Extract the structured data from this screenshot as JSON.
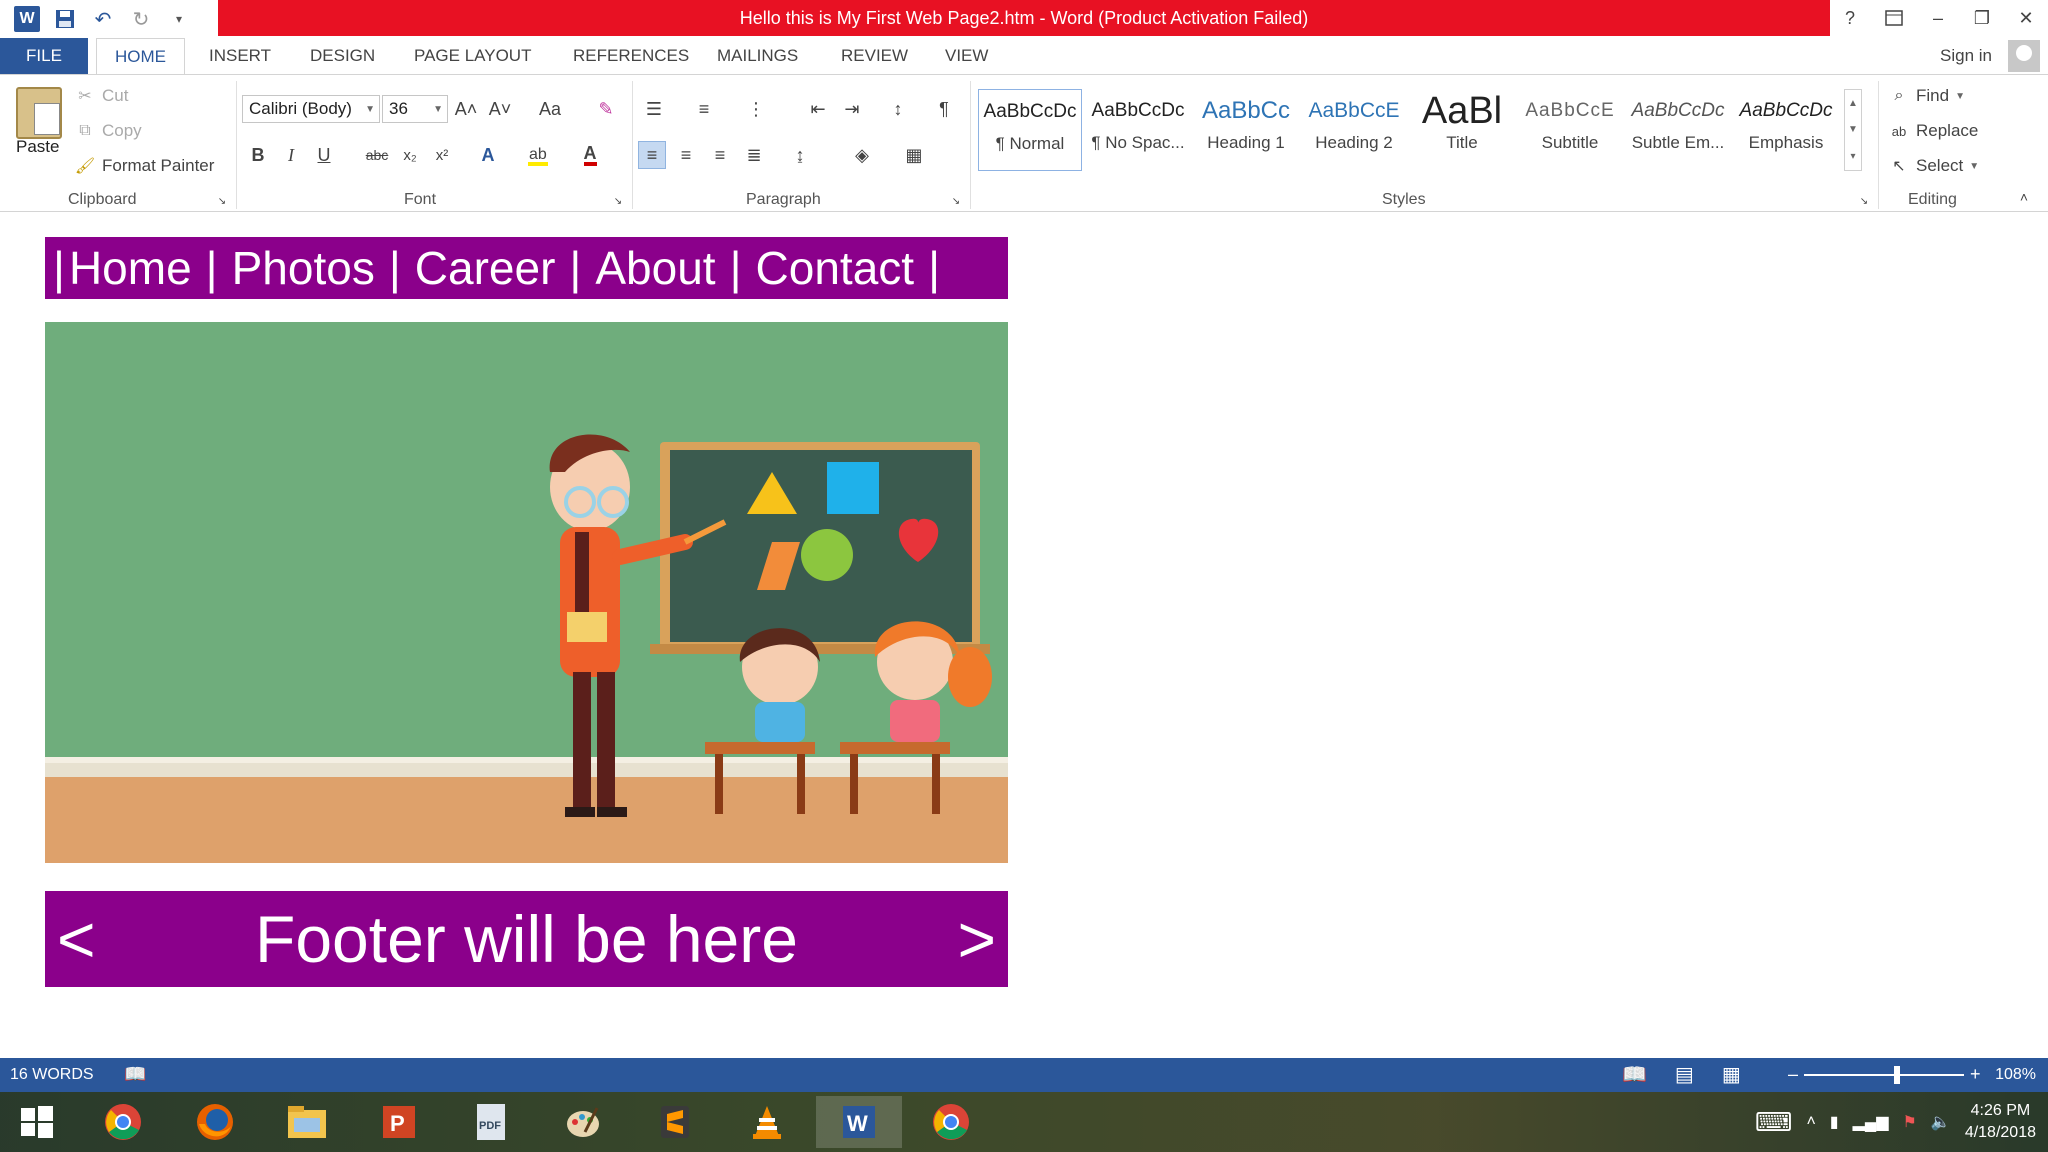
{
  "window": {
    "title": "Hello this is My First Web Page2.htm -  Word (Product Activation Failed)",
    "help": "?",
    "minimize": "–",
    "restore": "❐",
    "close": "✕"
  },
  "ribbon_tabs": {
    "file": "FILE",
    "items": [
      "HOME",
      "INSERT",
      "DESIGN",
      "PAGE LAYOUT",
      "REFERENCES",
      "MAILINGS",
      "REVIEW",
      "VIEW"
    ],
    "sign_in": "Sign in"
  },
  "clipboard": {
    "paste": "Paste",
    "cut": "Cut",
    "copy": "Copy",
    "format_painter": "Format Painter",
    "group": "Clipboard"
  },
  "font": {
    "name": "Calibri (Body)",
    "size": "36",
    "group": "Font",
    "bold": "B",
    "italic": "I",
    "underline": "U",
    "strike": "abc",
    "sub": "x₂",
    "sup": "x²",
    "grow": "A˄",
    "shrink": "A˅",
    "case": "Aa",
    "effects": "A",
    "color_a": "A"
  },
  "paragraph": {
    "group": "Paragraph"
  },
  "styles": {
    "group": "Styles",
    "items": [
      {
        "sample": "AaBbCcDc",
        "name": "¶ Normal"
      },
      {
        "sample": "AaBbCcDc",
        "name": "¶ No Spac..."
      },
      {
        "sample": "AaBbCc",
        "name": "Heading 1"
      },
      {
        "sample": "AaBbCcE",
        "name": "Heading 2"
      },
      {
        "sample": "AaBl",
        "name": "Title"
      },
      {
        "sample": "AaBbCcE",
        "name": "Subtitle"
      },
      {
        "sample": "AaBbCcDc",
        "name": "Subtle Em..."
      },
      {
        "sample": "AaBbCcDc",
        "name": "Emphasis"
      }
    ]
  },
  "editing": {
    "find": "Find",
    "replace": "Replace",
    "select": "Select",
    "group": "Editing"
  },
  "document": {
    "nav_items": [
      "Home",
      "Photos",
      "Career",
      "About",
      "Contact"
    ],
    "nav_separator": "|",
    "footer_text": "Footer will be here",
    "footer_left": "<",
    "footer_right": ">"
  },
  "status": {
    "words": "16 WORDS",
    "zoom": "108%",
    "zoom_out": "–",
    "zoom_in": "+"
  },
  "taskbar": {
    "apps": [
      "chrome-icon",
      "firefox-icon",
      "file-explorer-icon",
      "powerpoint-icon",
      "pdf-icon",
      "paint-icon",
      "sublime-icon",
      "vlc-icon",
      "word-icon",
      "chrome-icon"
    ],
    "time": "4:26 PM",
    "date": "4/18/2018"
  },
  "colors": {
    "word_blue": "#2b579a",
    "title_red": "#e81123",
    "nav_purple": "#8b008b"
  }
}
